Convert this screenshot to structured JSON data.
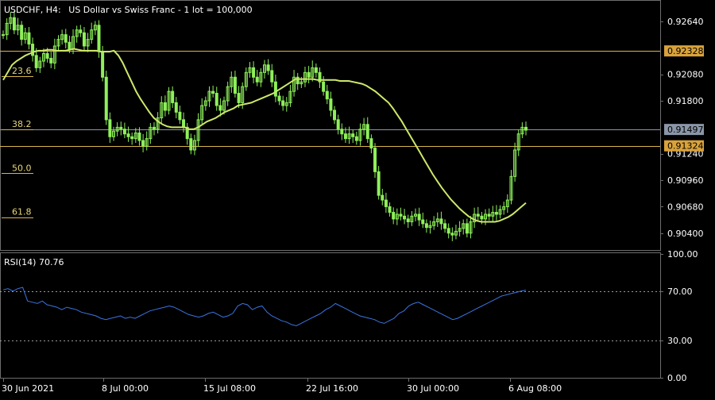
{
  "colors": {
    "background": "#000000",
    "candle": "#8ef05a",
    "moving_average": "#cde86a",
    "fib_line": "#d9b54a",
    "price_line": "#8a97a8",
    "rsi_line": "#3a74e0",
    "level_line": "#9a9a9a",
    "axis_text": "#ffffff",
    "fib_label_text": "#e6d67a",
    "orange_tag": "#d9a23a",
    "grey_tag": "#8a97a8"
  },
  "header": {
    "symbol_timeframe": "USDCHF, H4:",
    "description": "US Dollar vs Swiss Franc",
    "lot": "- 1 lot = 100,000"
  },
  "chart_data": [
    {
      "type": "candlestick",
      "title": "USDCHF, H4:  US Dollar vs Swiss Franc- 1 lot = 100,000",
      "y_tick_labels": [
        "0.92640",
        "0.92080",
        "0.91800",
        "0.91240",
        "0.90960",
        "0.90680",
        "0.90400"
      ],
      "y_ticks": [
        0.9264,
        0.9208,
        0.918,
        0.9124,
        0.9096,
        0.9068,
        0.904
      ],
      "ylim": [
        0.9023,
        0.9285
      ],
      "tags": [
        {
          "label": "0.92328",
          "value": 0.92328,
          "style": "orange"
        },
        {
          "label": "0.91497",
          "value": 0.91497,
          "style": "grey"
        },
        {
          "label": "0.91324",
          "value": 0.91324,
          "style": "orange"
        }
      ],
      "fib_levels": [
        {
          "label": "23.6",
          "value": 0.92059
        },
        {
          "label": "38.2",
          "value": 0.91497
        },
        {
          "label": "50.0",
          "value": 0.91034
        },
        {
          "label": "61.8",
          "value": 0.90568
        }
      ],
      "horizontal_lines": [
        {
          "value": 0.92328,
          "style": "fib"
        },
        {
          "value": 0.91497,
          "style": "price"
        },
        {
          "value": 0.91324,
          "style": "fib"
        }
      ],
      "series": [
        {
          "values": [
            0.925,
            0.9262,
            0.9268,
            0.9255,
            0.926,
            0.9245,
            0.9252,
            0.924,
            0.9228,
            0.9215,
            0.9222,
            0.923,
            0.9225,
            0.922,
            0.9238,
            0.9245,
            0.925,
            0.9242,
            0.9235,
            0.9248,
            0.9255,
            0.9252,
            0.9238,
            0.9245,
            0.9255,
            0.926,
            0.9232,
            0.9205,
            0.916,
            0.9142,
            0.9148,
            0.9152,
            0.915,
            0.9145,
            0.9142,
            0.914,
            0.9146,
            0.9138,
            0.9132,
            0.914,
            0.9152,
            0.915,
            0.9162,
            0.9178,
            0.917,
            0.919,
            0.9178,
            0.9168,
            0.916,
            0.9152,
            0.914,
            0.9128,
            0.9138,
            0.916,
            0.9175,
            0.918,
            0.919,
            0.9188,
            0.9175,
            0.917,
            0.918,
            0.9195,
            0.9205,
            0.9188,
            0.9178,
            0.9195,
            0.921,
            0.9215,
            0.9205,
            0.92,
            0.921,
            0.9218,
            0.9212,
            0.92,
            0.9185,
            0.918,
            0.9175,
            0.9178,
            0.919,
            0.9205,
            0.9198,
            0.92,
            0.921,
            0.9205,
            0.9215,
            0.921,
            0.92,
            0.919,
            0.9182,
            0.917,
            0.916,
            0.915,
            0.9145,
            0.914,
            0.9145,
            0.9142,
            0.9138,
            0.915,
            0.9155,
            0.914,
            0.913,
            0.9105,
            0.908,
            0.9075,
            0.9068,
            0.9062,
            0.9055,
            0.906,
            0.9058,
            0.9055,
            0.9052,
            0.9058,
            0.906,
            0.9054,
            0.905,
            0.9046,
            0.9048,
            0.9052,
            0.9055,
            0.905,
            0.9045,
            0.904,
            0.9038,
            0.9042,
            0.9045,
            0.905,
            0.904,
            0.9052,
            0.906,
            0.9058,
            0.9055,
            0.906,
            0.9058,
            0.9062,
            0.906,
            0.9065,
            0.9068,
            0.9075,
            0.91,
            0.9128,
            0.9145,
            0.9152,
            0.9149
          ],
          "name": ""
        },
        {
          "values": [
            0.9202,
            0.921,
            0.9218,
            0.9222,
            0.9225,
            0.9228,
            0.923,
            0.9232,
            0.9233,
            0.9233,
            0.9234,
            0.9234,
            0.9233,
            0.9233,
            0.9233,
            0.9234,
            0.9235,
            0.9234,
            0.9233,
            0.9233,
            0.9233,
            0.9233,
            0.9232,
            0.9232,
            0.9232,
            0.9233,
            0.9228,
            0.922,
            0.921,
            0.92,
            0.919,
            0.9182,
            0.9175,
            0.9168,
            0.9162,
            0.9158,
            0.9155,
            0.9153,
            0.9152,
            0.9152,
            0.9152,
            0.9152,
            0.915,
            0.915,
            0.9152,
            0.9155,
            0.9158,
            0.916,
            0.9162,
            0.9165,
            0.9168,
            0.917,
            0.9172,
            0.9175,
            0.9176,
            0.9177,
            0.9178,
            0.918,
            0.9182,
            0.9184,
            0.9186,
            0.9188,
            0.9191,
            0.9194,
            0.9197,
            0.92,
            0.9203,
            0.9203,
            0.9203,
            0.9203,
            0.9203,
            0.9202,
            0.9202,
            0.9202,
            0.9202,
            0.9202,
            0.9201,
            0.9201,
            0.9201,
            0.92,
            0.9199,
            0.9198,
            0.9196,
            0.9193,
            0.919,
            0.9186,
            0.9182,
            0.9178,
            0.9172,
            0.9165,
            0.9158,
            0.915,
            0.9142,
            0.9134,
            0.9126,
            0.9118,
            0.911,
            0.9102,
            0.9095,
            0.9088,
            0.9082,
            0.9076,
            0.9071,
            0.9066,
            0.9062,
            0.9058,
            0.9055,
            0.9053,
            0.9052,
            0.9052,
            0.9052,
            0.9052,
            0.9053,
            0.9055,
            0.9057,
            0.906,
            0.9064,
            0.9068,
            0.9072
          ],
          "name": ""
        }
      ]
    },
    {
      "type": "line",
      "title": "RSI(14) 70.76",
      "y_tick_labels": [
        "100.00",
        "70.00",
        "30.00",
        "0.00"
      ],
      "y_ticks": [
        100,
        70,
        30,
        0
      ],
      "ylim": [
        0,
        100
      ],
      "levels": [
        70,
        30
      ],
      "series": [
        {
          "values": [
            71,
            72,
            70,
            72,
            73,
            62,
            61,
            60,
            62,
            59,
            58,
            57,
            55,
            57,
            56,
            55,
            53,
            52,
            51,
            50,
            48,
            47,
            48,
            49,
            50,
            48,
            49,
            48,
            50,
            52,
            54,
            55,
            56,
            57,
            58,
            57,
            55,
            53,
            51,
            50,
            49,
            50,
            52,
            53,
            51,
            49,
            50,
            52,
            58,
            60,
            59,
            55,
            57,
            58,
            53,
            50,
            48,
            46,
            45,
            43,
            42,
            44,
            46,
            48,
            50,
            52,
            55,
            57,
            60,
            58,
            56,
            54,
            52,
            50,
            49,
            48,
            47,
            45,
            44,
            46,
            48,
            52,
            54,
            58,
            60,
            61,
            59,
            57,
            55,
            53,
            51,
            49,
            47,
            48,
            50,
            52,
            54,
            56,
            58,
            60,
            62,
            64,
            66,
            67,
            68,
            69,
            70,
            70.76
          ],
          "name": ""
        }
      ]
    }
  ],
  "x_axis": {
    "labels": [
      "30 Jun 2021",
      "8 Jul 00:00",
      "15 Jul 08:00",
      "22 Jul 16:00",
      "30 Jul 00:00",
      "6 Aug 08:00"
    ]
  }
}
